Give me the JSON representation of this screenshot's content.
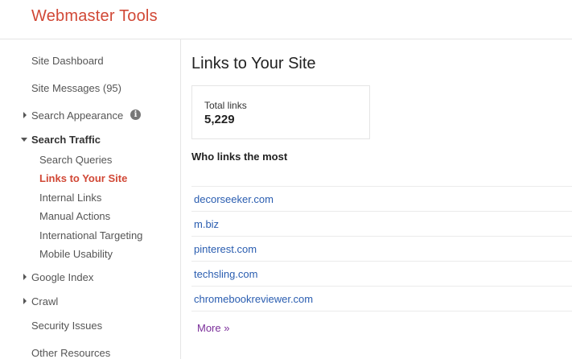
{
  "header": {
    "title": "Webmaster Tools"
  },
  "sidebar": {
    "site_dashboard": "Site Dashboard",
    "site_messages": "Site Messages (95)",
    "search_appearance": "Search Appearance",
    "search_appearance_info_icon": "info-icon",
    "search_traffic": "Search Traffic",
    "search_traffic_items": [
      "Search Queries",
      "Links to Your Site",
      "Internal Links",
      "Manual Actions",
      "International Targeting",
      "Mobile Usability"
    ],
    "google_index": "Google Index",
    "crawl": "Crawl",
    "security_issues": "Security Issues",
    "other_resources": "Other Resources"
  },
  "main": {
    "page_title": "Links to Your Site",
    "total_links": {
      "label": "Total links",
      "value": "5,229"
    },
    "who_links_heading": "Who links the most",
    "linking_domains": [
      "decorseeker.com",
      "m.biz",
      "pinterest.com",
      "techsling.com",
      "chromebookreviewer.com"
    ],
    "more_link": "More »"
  },
  "colors": {
    "brand_red": "#d14836",
    "link_blue": "#2a5db0",
    "visited_purple": "#7b2f9a"
  }
}
